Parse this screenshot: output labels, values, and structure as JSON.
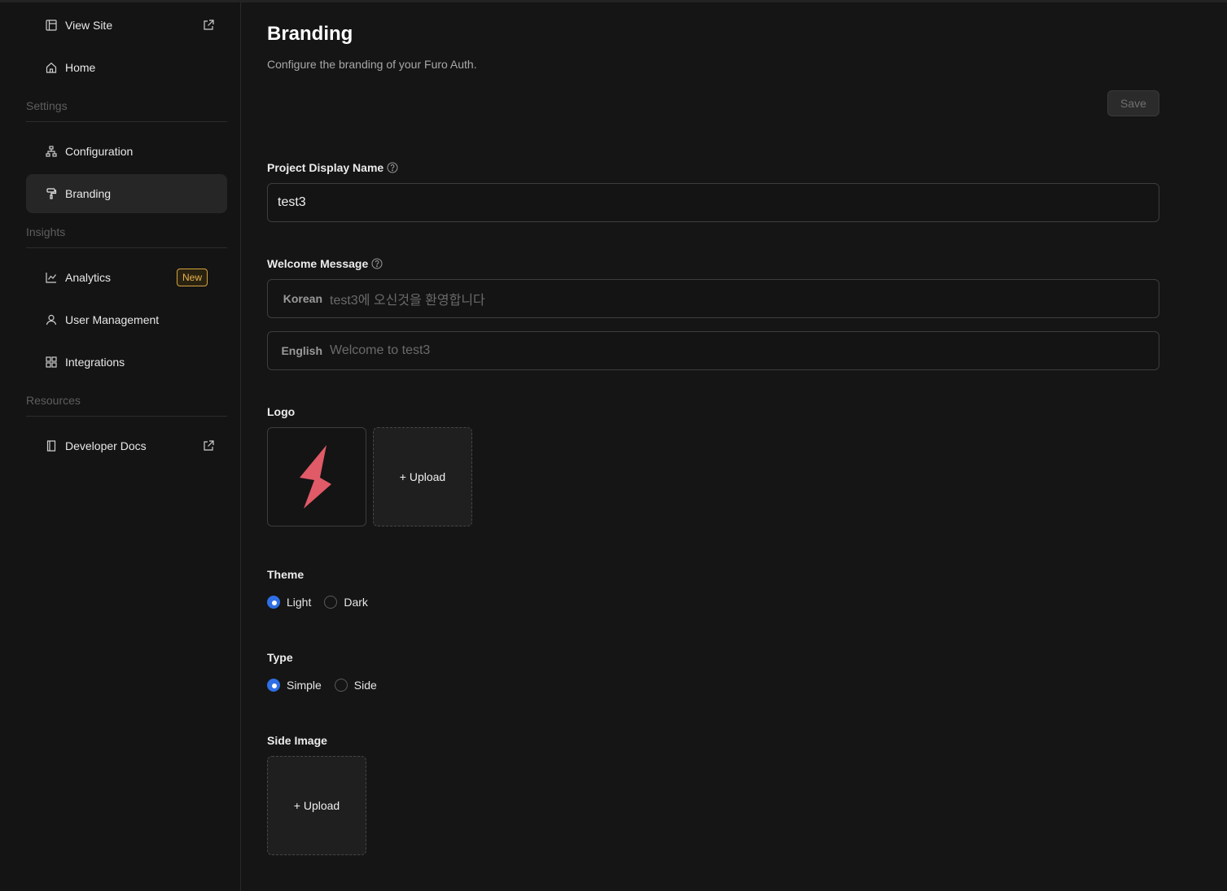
{
  "sidebar": {
    "items": [
      {
        "label": "View Site"
      },
      {
        "label": "Home"
      },
      {
        "label": "Configuration"
      },
      {
        "label": "Branding"
      },
      {
        "label": "Analytics",
        "badge": "New"
      },
      {
        "label": "User Management"
      },
      {
        "label": "Integrations"
      },
      {
        "label": "Developer Docs"
      }
    ],
    "sections": {
      "settings": "Settings",
      "insights": "Insights",
      "resources": "Resources"
    }
  },
  "header": {
    "title": "Branding",
    "subtitle": "Configure the branding of your Furo Auth.",
    "save_label": "Save"
  },
  "form": {
    "display_name": {
      "label": "Project Display Name",
      "value": "test3"
    },
    "welcome": {
      "label": "Welcome Message",
      "korean_prefix": "Korean",
      "korean_placeholder": "test3에 오신것을 환영합니다",
      "english_prefix": "English",
      "english_placeholder": "Welcome to test3"
    },
    "logo": {
      "label": "Logo",
      "upload_label": "+ Upload"
    },
    "theme": {
      "label": "Theme",
      "options": [
        "Light",
        "Dark"
      ],
      "selected": "Light"
    },
    "type": {
      "label": "Type",
      "options": [
        "Simple",
        "Side"
      ],
      "selected": "Simple"
    },
    "side_image": {
      "label": "Side Image",
      "upload_label": "+ Upload"
    }
  },
  "colors": {
    "accent": "#2f6fe4",
    "logo": "#e05a67",
    "badge": "#e7b34e"
  }
}
